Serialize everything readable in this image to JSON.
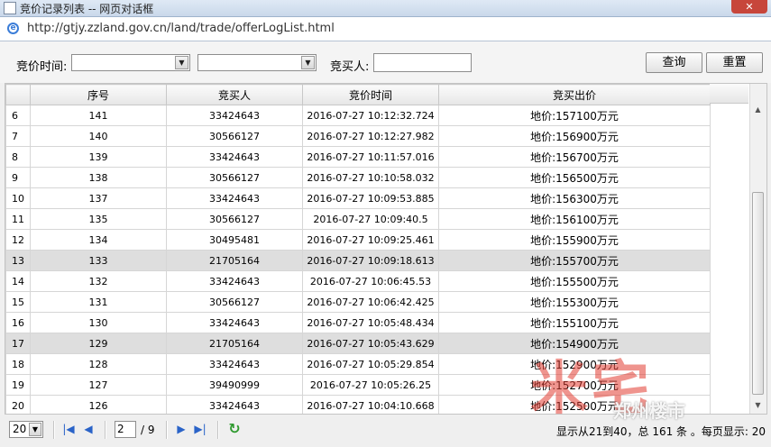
{
  "window": {
    "title": "竞价记录列表 -- 网页对话框",
    "close_label": "✕"
  },
  "address": {
    "url": "http://gtjy.zzland.gov.cn/land/trade/offerLogList.html"
  },
  "filters": {
    "time_label": "竞价时间:",
    "buyer_label": "竞买人:",
    "time_from_value": "",
    "time_to_value": "",
    "buyer_value": "",
    "query_button": "查询",
    "reset_button": "重置"
  },
  "table": {
    "columns": [
      "",
      "序号",
      "竞买人",
      "竞价时间",
      "竞买出价"
    ],
    "rows": [
      {
        "idx": "6",
        "seq": "141",
        "buyer": "33424643",
        "time": "2016-07-27 10:12:32.724",
        "price": "地价:157100万元"
      },
      {
        "idx": "7",
        "seq": "140",
        "buyer": "30566127",
        "time": "2016-07-27 10:12:27.982",
        "price": "地价:156900万元"
      },
      {
        "idx": "8",
        "seq": "139",
        "buyer": "33424643",
        "time": "2016-07-27 10:11:57.016",
        "price": "地价:156700万元"
      },
      {
        "idx": "9",
        "seq": "138",
        "buyer": "30566127",
        "time": "2016-07-27 10:10:58.032",
        "price": "地价:156500万元"
      },
      {
        "idx": "10",
        "seq": "137",
        "buyer": "33424643",
        "time": "2016-07-27 10:09:53.885",
        "price": "地价:156300万元"
      },
      {
        "idx": "11",
        "seq": "135",
        "buyer": "30566127",
        "time": "2016-07-27 10:09:40.5",
        "price": "地价:156100万元"
      },
      {
        "idx": "12",
        "seq": "134",
        "buyer": "30495481",
        "time": "2016-07-27 10:09:25.461",
        "price": "地价:155900万元"
      },
      {
        "idx": "13",
        "seq": "133",
        "buyer": "21705164",
        "time": "2016-07-27 10:09:18.613",
        "price": "地价:155700万元"
      },
      {
        "idx": "14",
        "seq": "132",
        "buyer": "33424643",
        "time": "2016-07-27 10:06:45.53",
        "price": "地价:155500万元"
      },
      {
        "idx": "15",
        "seq": "131",
        "buyer": "30566127",
        "time": "2016-07-27 10:06:42.425",
        "price": "地价:155300万元"
      },
      {
        "idx": "16",
        "seq": "130",
        "buyer": "33424643",
        "time": "2016-07-27 10:05:48.434",
        "price": "地价:155100万元"
      },
      {
        "idx": "17",
        "seq": "129",
        "buyer": "21705164",
        "time": "2016-07-27 10:05:43.629",
        "price": "地价:154900万元"
      },
      {
        "idx": "18",
        "seq": "128",
        "buyer": "33424643",
        "time": "2016-07-27 10:05:29.854",
        "price": "地价:152900万元"
      },
      {
        "idx": "19",
        "seq": "127",
        "buyer": "39490999",
        "time": "2016-07-27 10:05:26.25",
        "price": "地价:152700万元"
      },
      {
        "idx": "20",
        "seq": "126",
        "buyer": "33424643",
        "time": "2016-07-27 10:04:10.668",
        "price": "地价:152500万元"
      }
    ],
    "highlighted_rows": [
      7,
      11
    ]
  },
  "pager": {
    "page_size": "20",
    "current_page": "2",
    "total_pages": "/ 9",
    "info": "显示从21到40，总 161 条 。每页显示: 20"
  },
  "watermark": {
    "text": "米宅",
    "sub": "郑州楼市"
  },
  "icons": {
    "first": "first-page-icon",
    "prev": "prev-page-icon",
    "next": "next-page-icon",
    "last": "last-page-icon",
    "refresh": "refresh-icon"
  }
}
